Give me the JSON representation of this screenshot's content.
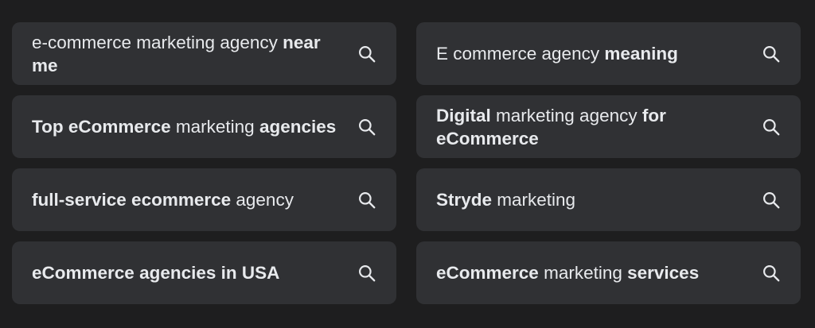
{
  "suggestions": [
    {
      "segments": [
        {
          "t": "e-commerce marketing agency ",
          "b": false
        },
        {
          "t": "near me",
          "b": true
        }
      ],
      "icon": "search-icon"
    },
    {
      "segments": [
        {
          "t": "E commerce agency ",
          "b": false
        },
        {
          "t": "meaning",
          "b": true
        }
      ],
      "icon": "search-icon"
    },
    {
      "segments": [
        {
          "t": "Top eCommerce",
          "b": true
        },
        {
          "t": " marketing ",
          "b": false
        },
        {
          "t": "agencies",
          "b": true
        }
      ],
      "icon": "search-icon"
    },
    {
      "segments": [
        {
          "t": "Digital",
          "b": true
        },
        {
          "t": " marketing agency ",
          "b": false
        },
        {
          "t": "for eCommerce",
          "b": true
        }
      ],
      "icon": "search-icon"
    },
    {
      "segments": [
        {
          "t": "full-service ecommerce",
          "b": true
        },
        {
          "t": " agency",
          "b": false
        }
      ],
      "icon": "search-icon"
    },
    {
      "segments": [
        {
          "t": "Stryde",
          "b": true
        },
        {
          "t": " marketing",
          "b": false
        }
      ],
      "icon": "search-icon"
    },
    {
      "segments": [
        {
          "t": "eCommerce agencies in USA",
          "b": true
        }
      ],
      "icon": "search-icon"
    },
    {
      "segments": [
        {
          "t": "eCommerce",
          "b": true
        },
        {
          "t": " marketing ",
          "b": false
        },
        {
          "t": "services",
          "b": true
        }
      ],
      "icon": "search-icon"
    }
  ],
  "colors": {
    "background": "#1e1e1f",
    "chip": "#303134",
    "text": "#e8eaed",
    "icon": "#e8eaed"
  }
}
